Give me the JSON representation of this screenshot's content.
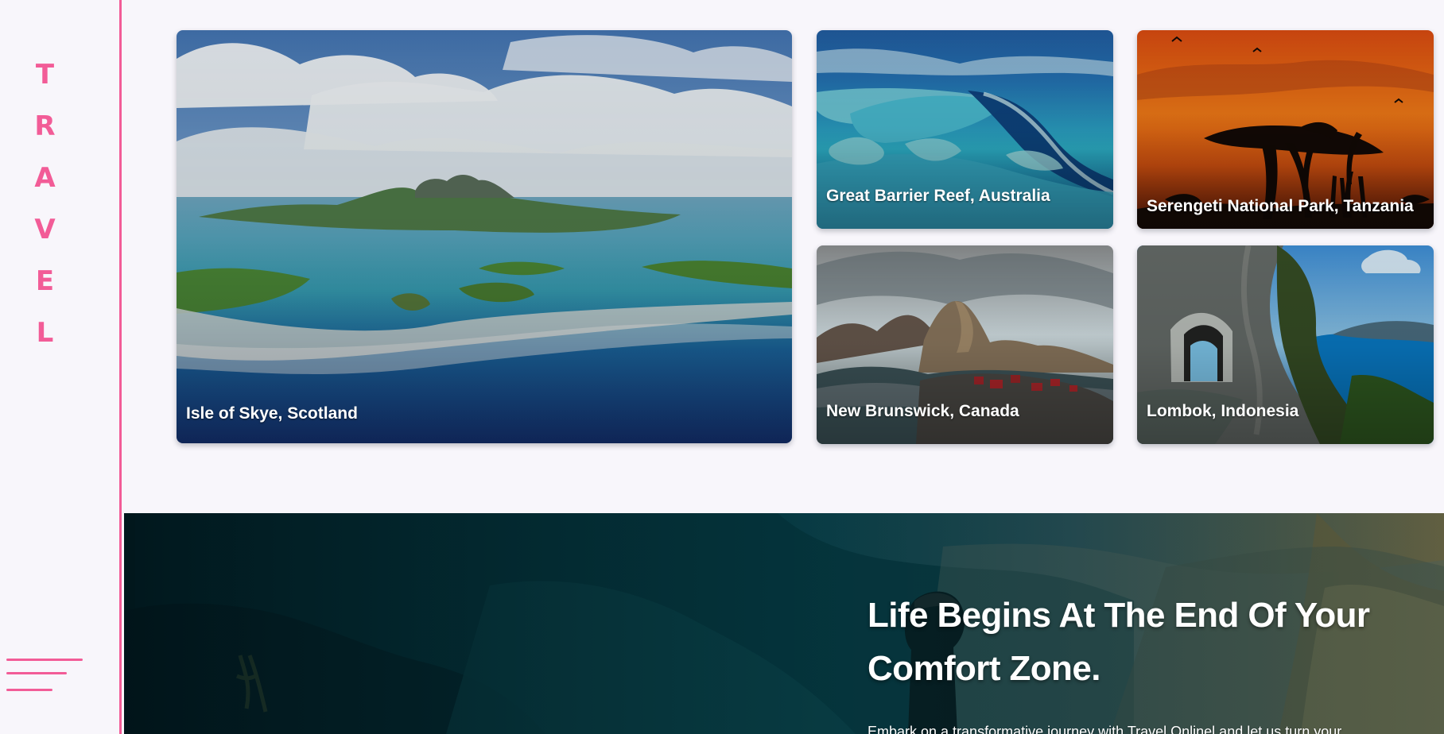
{
  "sidebar": {
    "brand_letters": [
      "T",
      "R",
      "A",
      "V",
      "E",
      "L"
    ],
    "menu_icon": "hamburger-icon",
    "accent_color": "#f25c97"
  },
  "gallery": {
    "cards": [
      {
        "label": "Isle of Skye, Scotland"
      },
      {
        "label": "Great Barrier Reef, Australia"
      },
      {
        "label": "Serengeti National Park, Tanzania"
      },
      {
        "label": "New Brunswick, Canada"
      },
      {
        "label": "Lombok, Indonesia"
      }
    ]
  },
  "hero": {
    "title": "Life Begins At The End Of Your Comfort Zone.",
    "text": "Embark on a transformative journey with Travel Onlinel and let us turn your"
  }
}
